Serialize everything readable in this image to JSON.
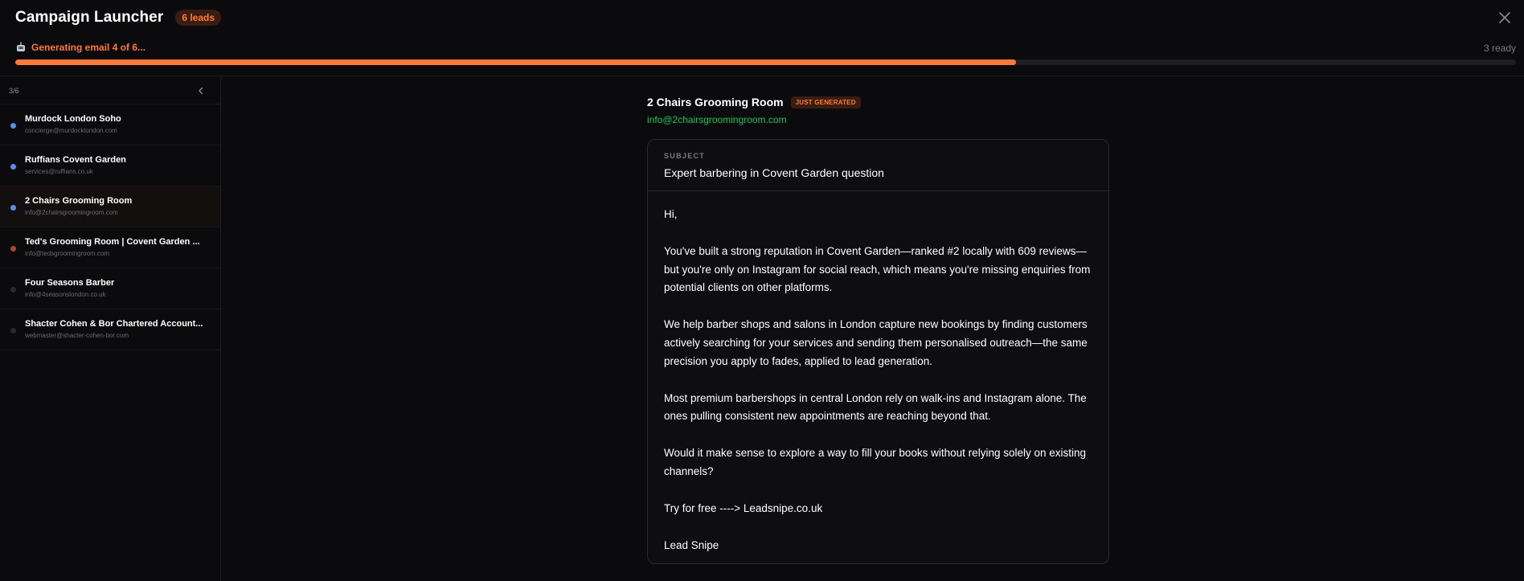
{
  "header": {
    "title": "Campaign Launcher",
    "leads_badge": "6 leads",
    "status_text": "Generating email 4 of 6...",
    "ready_text": "3 ready",
    "progress_fraction": 0.667,
    "status_icon": "robot-icon",
    "close_icon": "close-icon"
  },
  "sidebar": {
    "count": "3/6",
    "collapse_icon": "chevron-left-icon",
    "items": [
      {
        "name": "Murdock London Soho",
        "email": "concierge@murdocklondon.com",
        "status_color": "#5b8def"
      },
      {
        "name": "Ruffians Covent Garden",
        "email": "services@ruffians.co.uk",
        "status_color": "#5b8def"
      },
      {
        "name": "2 Chairs Grooming Room",
        "email": "info@2chairsgroomingroom.com",
        "status_color": "#5b8def"
      },
      {
        "name": "Ted's Grooming Room | Covent Garden ...",
        "email": "info@tedsgroomingroom.com",
        "status_color": "#b2452a"
      },
      {
        "name": "Four Seasons Barber",
        "email": "info@4seasonslondon.co.uk",
        "status_color": "#2a2a2e"
      },
      {
        "name": "Shacter Cohen & Bor Chartered Account...",
        "email": "webmaster@shacter-cohen-bor.com",
        "status_color": "#2a2a2e"
      }
    ]
  },
  "main": {
    "company_name": "2 Chairs Grooming Room",
    "badge": "JUST GENERATED",
    "company_email": "info@2chairsgroomingroom.com",
    "subject_label": "SUBJECT",
    "subject": "Expert barbering in Covent Garden question",
    "body": [
      "Hi,",
      "You've built a strong reputation in Covent Garden—ranked #2 locally with 609 reviews—but you're only on Instagram for social reach, which means you're missing enquiries from potential clients on other platforms.",
      "We help barber shops and salons in London capture new bookings by finding customers actively searching for your services and sending them personalised outreach—the same precision you apply to fades, applied to lead generation.",
      "Most premium barbershops in central London rely on walk-ins and Instagram alone. The ones pulling consistent new appointments are reaching beyond that.",
      "Would it make sense to explore a way to fill your books without relying solely on existing channels?",
      "Try for free ----> Leadsnipe.co.uk",
      "Lead Snipe"
    ]
  },
  "colors": {
    "accent": "#ff7a3a",
    "email_green": "#22c55e",
    "background": "#0b0b0d"
  }
}
